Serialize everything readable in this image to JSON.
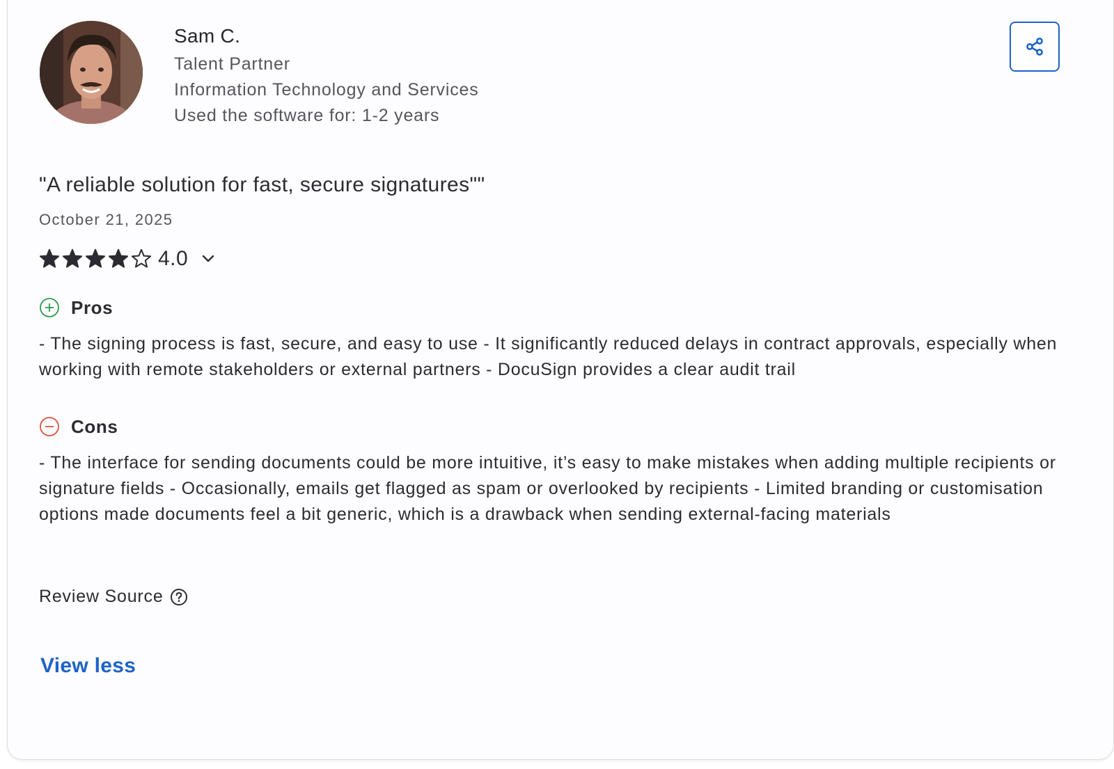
{
  "reviewer": {
    "name": "Sam C.",
    "role": "Talent Partner",
    "industry": "Information Technology and Services",
    "usage": "Used the software for: 1-2 years"
  },
  "actions": {
    "share_icon": "share-icon"
  },
  "review": {
    "title": "\"A reliable solution for fast, secure signatures\"\"",
    "date": "October 21, 2025",
    "rating": 4.0,
    "rating_label": "4.0",
    "rating_max": 5,
    "pros": {
      "label": "Pros",
      "text": "- The signing process is fast, secure, and easy to use - It significantly reduced delays in contract approvals, especially when working with remote stakeholders or external partners - DocuSign provides a clear audit trail"
    },
    "cons": {
      "label": "Cons",
      "text": "- The interface for sending documents could be more intuitive, it’s easy to make mistakes when adding multiple recipients or signature fields - Occasionally, emails get flagged as spam or overlooked by recipients - Limited branding or customisation options made documents feel a bit generic, which is a drawback when sending external-facing materials"
    }
  },
  "footer": {
    "review_source_label": "Review Source",
    "view_less_label": "View less"
  },
  "colors": {
    "accent": "#1d63c7",
    "pros": "#2e9a4a",
    "cons": "#e0523f",
    "star": "#2b2b31"
  }
}
